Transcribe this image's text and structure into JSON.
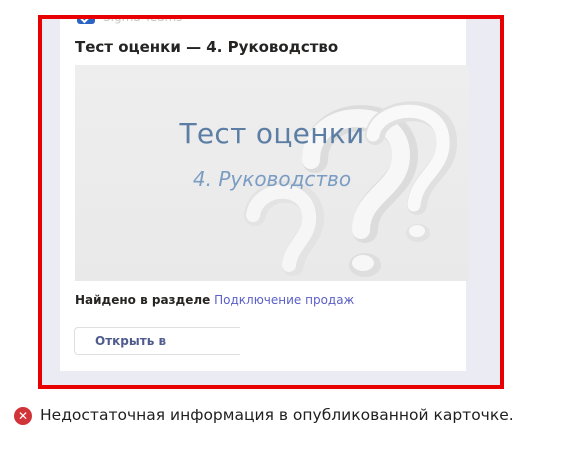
{
  "card": {
    "app_icon": "check-app-icon",
    "app_name": "Sigma Teams",
    "title": "Тест оценки — 4. Руководство",
    "hero": {
      "title": "Тест оценки",
      "subtitle": "4. Руководство",
      "background_motif": "question-marks"
    },
    "found_in": {
      "label": "Найдено в разделе",
      "section": "Подключение продаж"
    },
    "open_button_label": "Открыть в"
  },
  "status": {
    "icon": "error-x-icon",
    "message": "Недостаточная информация в опубликованной карточке."
  },
  "colors": {
    "highlight_border": "#e80000",
    "accent_link": "#5b5fc7",
    "error": "#d13438",
    "hero_title": "#5c7ea5"
  }
}
